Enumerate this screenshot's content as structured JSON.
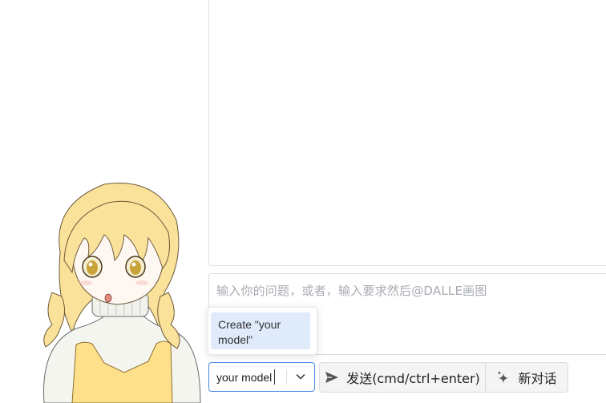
{
  "input": {
    "placeholder": "输入你的问题，或者，输入要求然后@DALLE画图"
  },
  "model_select": {
    "value": "your model",
    "dropdown_option": "Create \"your model\""
  },
  "buttons": {
    "send_label": "发送(cmd/ctrl+enter)",
    "new_chat_label": "新对话"
  },
  "icons": {
    "send": "send-icon",
    "new_chat": "sparkles-icon",
    "dropdown": "chevron-down-icon"
  },
  "colors": {
    "accent": "#4a89e8",
    "dropdown_highlight": "#dfeafb",
    "button_bg": "#f4f4f5",
    "placeholder": "#a8abb2"
  }
}
